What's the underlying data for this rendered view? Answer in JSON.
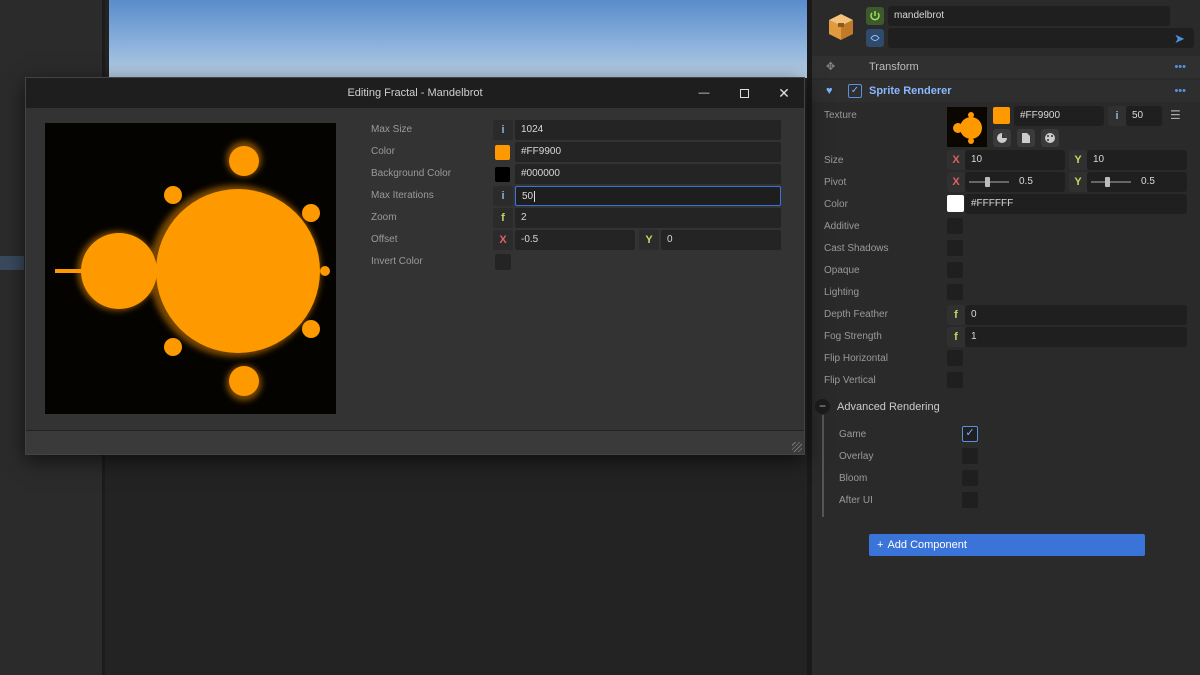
{
  "dialog": {
    "title": "Editing Fractal - Mandelbrot",
    "fields": {
      "max_size_label": "Max Size",
      "max_size_value": "1024",
      "color_label": "Color",
      "color_value": "#FF9900",
      "bg_color_label": "Background Color",
      "bg_color_value": "#000000",
      "max_iter_label": "Max Iterations",
      "max_iter_value": "50",
      "zoom_label": "Zoom",
      "zoom_value": "2",
      "offset_label": "Offset",
      "offset_x": "-0.5",
      "offset_y": "0",
      "invert_label": "Invert Color"
    },
    "tags": {
      "i": "i",
      "f": "f",
      "x": "X",
      "y": "Y"
    }
  },
  "inspector": {
    "entity_name": "mandelbrot",
    "transform_header": "Transform",
    "sprite_header": "Sprite Renderer",
    "texture_label": "Texture",
    "texture_color": "#FF9900",
    "texture_iter": "50",
    "size_label": "Size",
    "size_x": "10",
    "size_y": "10",
    "pivot_label": "Pivot",
    "pivot_x": "0.5",
    "pivot_y": "0.5",
    "color_label": "Color",
    "color_value": "#FFFFFF",
    "checks": [
      "Additive",
      "Cast Shadows",
      "Opaque",
      "Lighting"
    ],
    "depth_feather_label": "Depth Feather",
    "depth_feather_value": "0",
    "fog_strength_label": "Fog Strength",
    "fog_strength_value": "1",
    "flip_h_label": "Flip Horizontal",
    "flip_v_label": "Flip Vertical",
    "advanced_header": "Advanced Rendering",
    "advanced": [
      "Game",
      "Overlay",
      "Bloom",
      "After UI"
    ],
    "add_component": "Add Component"
  },
  "colors": {
    "accent": "#3a74d8",
    "fractal": "#FF9900"
  }
}
